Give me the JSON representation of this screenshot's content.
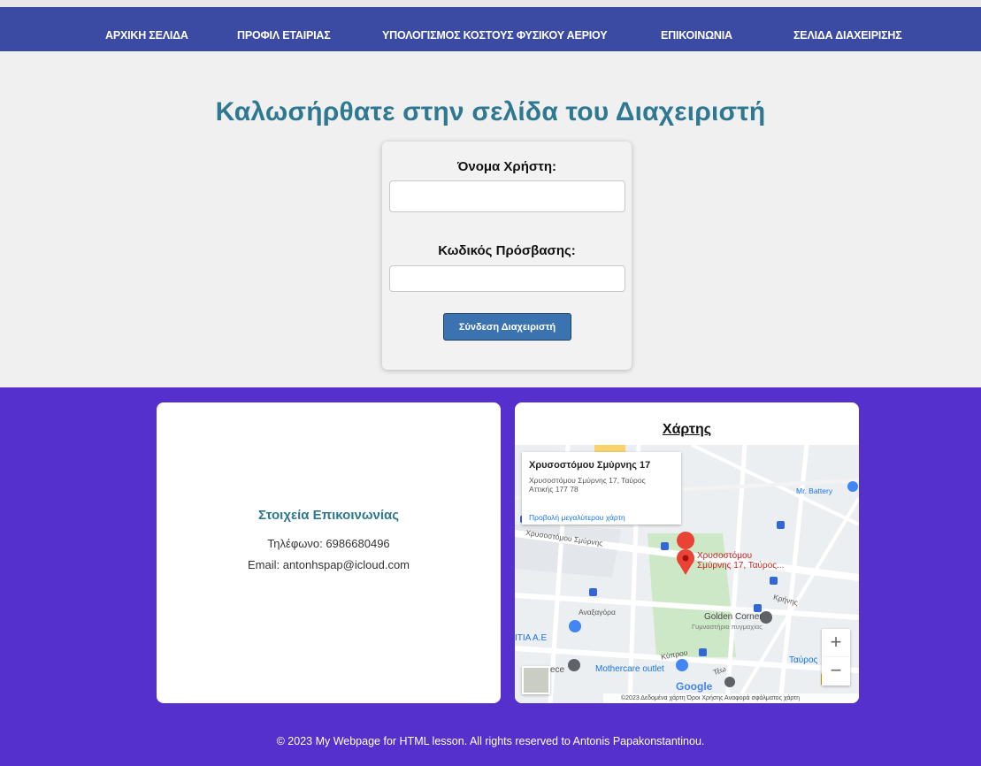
{
  "nav": {
    "items": [
      "ΑΡΧΙΚΗ ΣΕΛΙΔΑ",
      "ΠΡΟΦΙΛ ΕΤΑΙΡΙΑΣ",
      "ΥΠΟΛΟΓΙΣΜΟΣ ΚΟΣΤΟΥΣ ΦΥΣΙΚΟΥ ΑΕΡΙΟΥ",
      "ΕΠΙΚΟΙΝΩΝΙΑ",
      "ΣΕΛΙΔΑ ΔΙΑΧΕΙΡΙΣΗΣ"
    ]
  },
  "page": {
    "title": "Καλωσήρθατε στην σελίδα του Διαχειριστή"
  },
  "login": {
    "username_label": "Όνομα Χρήστη:",
    "username_value": "",
    "password_label": "Κωδικός Πρόσβασης:",
    "password_value": "",
    "submit_label": "Σύνδεση Διαχειριστή"
  },
  "contact": {
    "title": "Στοιχεία Επικοινωνίας",
    "phone": "Τηλέφωνο: 6986680496",
    "email": "Email: antonhspap@icloud.com"
  },
  "map": {
    "title": "Χάρτης",
    "info_title": "Χρυσοστόμου Σμύρνης 17",
    "info_address": "Χρυσοστόμου Σμύρνης 17, Ταύρος Αττικής 177 78",
    "info_link": "Προβολή μεγαλύτερου χάρτη",
    "pin_label_line1": "Χρυσοστόμου",
    "pin_label_line2": "Σμύρνης 17, Ταύρος...",
    "labels": {
      "street1": "Χρυσοστόμου Σμύρνης",
      "street2": "Κρήνης",
      "street3": "Αναξαγόρα",
      "street4": "Κύπρου",
      "street5": "Τέω",
      "place1": "Mr. Battery",
      "place2": "Golden Corner",
      "place2_sub": "Γυμναστήριο πυγμαχίας",
      "place3": "Mothercare outlet",
      "place4": "ΙΤΙΑ Α.Ε",
      "place5": "Ταύρος",
      "place6": "ece"
    },
    "zoom_in": "+",
    "zoom_out": "−",
    "google": "Google",
    "attribution": "©2023 Δεδομένα χάρτη   Όροι Χρήσης   Αναφορά σφάλματος χάρτη"
  },
  "footer": {
    "copyright": "© 2023 My Webpage for HTML lesson. All rights reserved to Antonis Papakonstantinou."
  }
}
